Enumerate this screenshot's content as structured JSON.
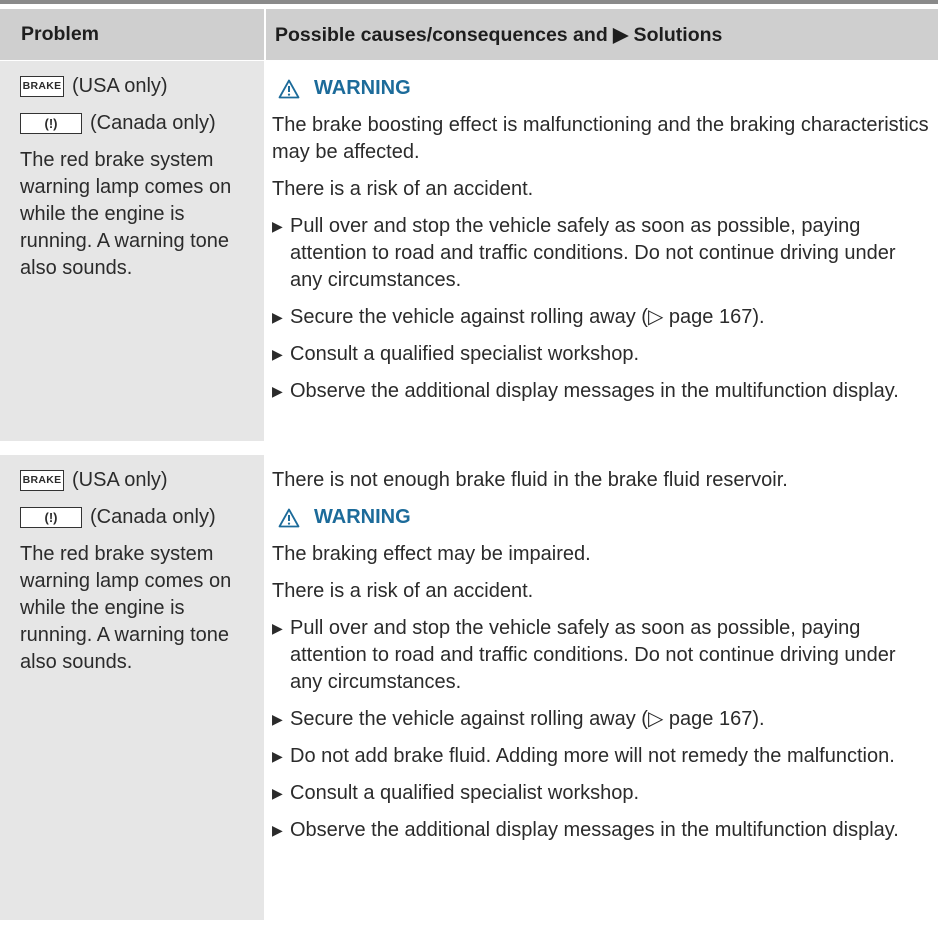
{
  "header": {
    "col1": "Problem",
    "col2": "Possible causes/consequences and ▶ Solutions"
  },
  "rows": [
    {
      "problem": {
        "brake_symbol": "BRAKE",
        "usa": "(USA only)",
        "canada_symbol": "(!)",
        "canada": "(Canada only)",
        "description": "The red brake system warning lamp comes on while the engine is running. A warning tone also sounds."
      },
      "solution": {
        "intro": "",
        "warning_label": "WARNING",
        "warning_text": "The brake boosting effect is malfunctioning and the braking characteristics may be affected.",
        "risk": "There is a risk of an accident.",
        "bullets": [
          "Pull over and stop the vehicle safely as soon as possible, paying attention to road and traffic conditions. Do not continue driving under any circumstances.",
          "Secure the vehicle against rolling away (▷ page 167).",
          "Consult a qualified specialist workshop.",
          "Observe the additional display messages in the multifunction display."
        ]
      }
    },
    {
      "problem": {
        "brake_symbol": "BRAKE",
        "usa": "(USA only)",
        "canada_symbol": "(!)",
        "canada": "(Canada only)",
        "description": "The red brake system warning lamp comes on while the engine is running. A warning tone also sounds."
      },
      "solution": {
        "intro": "There is not enough brake fluid in the brake fluid reservoir.",
        "warning_label": "WARNING",
        "warning_text": "The braking effect may be impaired.",
        "risk": "There is a risk of an accident.",
        "bullets": [
          "Pull over and stop the vehicle safely as soon as possible, paying attention to road and traffic conditions. Do not continue driving under any circumstances.",
          "Secure the vehicle against rolling away (▷ page 167).",
          "Do not add brake fluid. Adding more will not remedy the malfunction.",
          "Consult a qualified specialist workshop.",
          "Observe the additional display messages in the multifunction display."
        ]
      }
    }
  ],
  "colors": {
    "header_bg": "#cfcfcf",
    "problem_bg": "#e6e6e6",
    "warning_color": "#1c6b9a"
  },
  "icons": {
    "warning": "warning-triangle-icon",
    "bullet": "bullet-triangle-icon"
  }
}
